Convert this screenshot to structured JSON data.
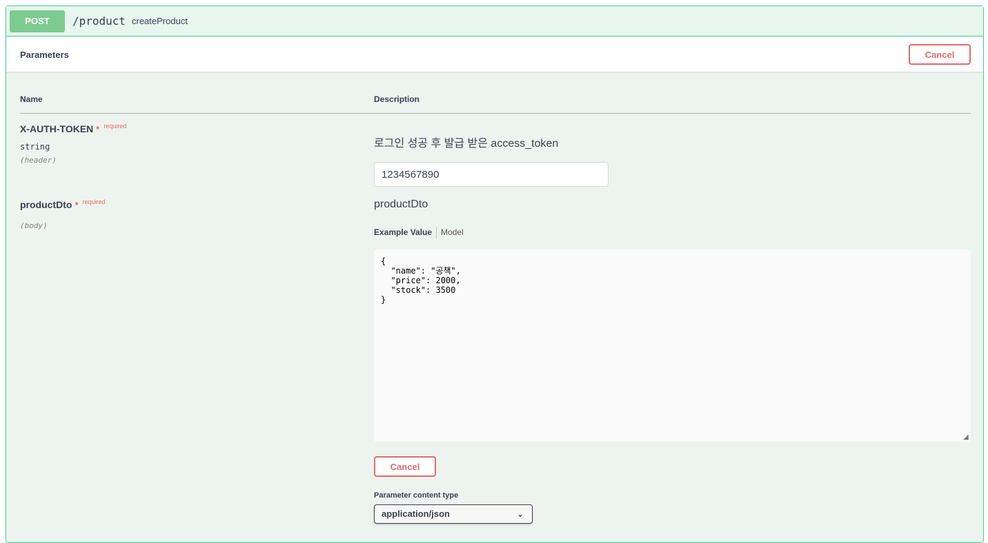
{
  "operation": {
    "method": "POST",
    "path": "/product",
    "operation_id": "createProduct"
  },
  "parameters_section": {
    "title": "Parameters",
    "cancel_label": "Cancel"
  },
  "columns": {
    "name": "Name",
    "description": "Description"
  },
  "params": [
    {
      "name": "X-AUTH-TOKEN",
      "required_star": "*",
      "required_text": "required",
      "type": "string",
      "in": "(header)",
      "description": "로그인 성공 후 발급 받은 access_token",
      "value": "1234567890"
    },
    {
      "name": "productDto",
      "required_star": "*",
      "required_text": "required",
      "in": "(body)",
      "description": "productDto",
      "tabs": [
        "Example Value",
        "Model"
      ],
      "body_value": "{\n  \"name\": \"공책\",\n  \"price\": 2000,\n  \"stock\": 3500\n}"
    }
  ],
  "body_cancel_label": "Cancel",
  "content_type": {
    "label": "Parameter content type",
    "selected": "application/json",
    "icon": "chevron-down-icon"
  },
  "colors": {
    "post_green": "#49cc90",
    "method_badge": "#7ecb91",
    "cancel_red": "#e06c6c",
    "panel_bg": "#edf3ee"
  }
}
